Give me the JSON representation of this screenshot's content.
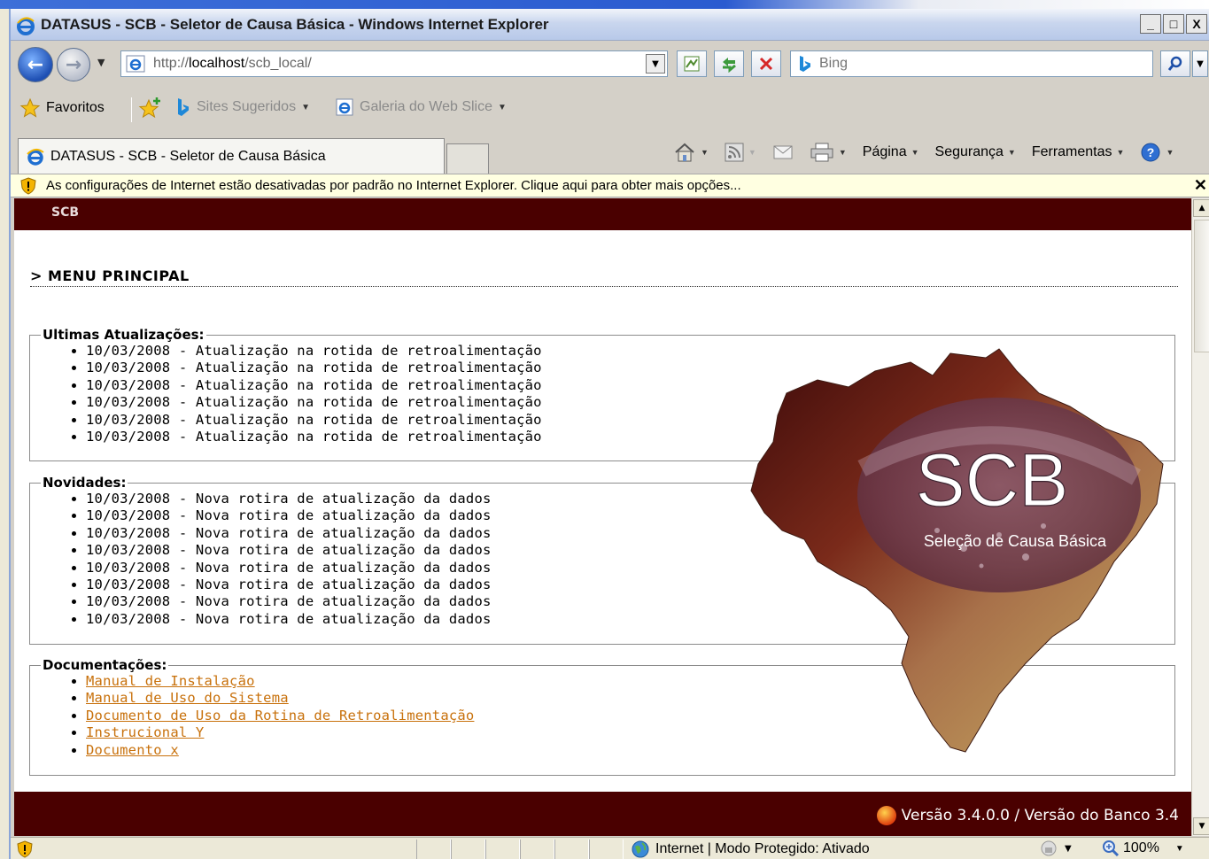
{
  "window": {
    "title": "DATASUS - SCB - Seletor de Causa Básica - Windows Internet Explorer",
    "minimize": "_",
    "maximize": "□",
    "close": "X"
  },
  "address": {
    "url_prefix": "http://",
    "url_host": "localhost",
    "url_path": "/scb_local/"
  },
  "search": {
    "placeholder": "Bing"
  },
  "favorites": {
    "label": "Favoritos",
    "items": [
      {
        "label": "Sites Sugeridos"
      },
      {
        "label": "Galeria do Web Slice"
      }
    ]
  },
  "tab": {
    "label": "DATASUS - SCB - Seletor de Causa Básica"
  },
  "command_bar": {
    "page": "Página",
    "security": "Segurança",
    "tools": "Ferramentas"
  },
  "infobar": {
    "message": "As configurações de Internet estão desativadas por padrão no Internet Explorer. Clique aqui para obter mais opções..."
  },
  "page": {
    "brand": "SCB",
    "menu_title": "> MENU PRINCIPAL",
    "updates": {
      "legend": "Ultimas Atualizações:",
      "items": [
        "10/03/2008 - Atualização na rotida de retroalimentação",
        "10/03/2008 - Atualização na rotida de retroalimentação",
        "10/03/2008 - Atualização na rotida de retroalimentação",
        "10/03/2008 - Atualização na rotida de retroalimentação",
        "10/03/2008 - Atualização na rotida de retroalimentação",
        "10/03/2008 - Atualização na rotida de retroalimentação"
      ]
    },
    "news": {
      "legend": "Novidades:",
      "items": [
        "10/03/2008 - Nova rotira de atualização da dados",
        "10/03/2008 - Nova rotira de atualização da dados",
        "10/03/2008 - Nova rotira de atualização da dados",
        "10/03/2008 - Nova rotira de atualização da dados",
        "10/03/2008 - Nova rotira de atualização da dados",
        "10/03/2008 - Nova rotira de atualização da dados",
        "10/03/2008 - Nova rotira de atualização da dados",
        "10/03/2008 - Nova rotira de atualização da dados"
      ]
    },
    "docs": {
      "legend": "Documentações:",
      "items": [
        "Manual de Instalação",
        "Manual de Uso do Sistema",
        "Documento de Uso da Rotina de Retroalimentação",
        "Instrucional Y",
        "Documento x"
      ]
    },
    "logo": {
      "title": "SCB",
      "subtitle": "Seleção de Causa Básica"
    },
    "footer": {
      "version": "Versão 3.4.0.0 / Versão do Banco 3.4"
    }
  },
  "status": {
    "zone": "Internet | Modo Protegido: Ativado",
    "zoom": "100%"
  },
  "colors": {
    "header_bg": "#4a0000",
    "link": "#c8710c",
    "infobar_bg": "#ffffe1"
  }
}
